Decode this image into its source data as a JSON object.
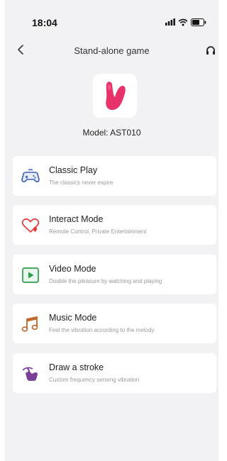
{
  "status_bar": {
    "time": "18:04",
    "icons": [
      "signal-icon",
      "wifi-icon",
      "battery-icon"
    ]
  },
  "nav": {
    "title": "Stand-alone game",
    "back_icon": "chevron-left-icon",
    "support_icon": "headset-icon"
  },
  "device": {
    "model_label": "Model: AST010",
    "image_icon": "device-product-image",
    "accent_color": "#e8336a"
  },
  "menu": {
    "items": [
      {
        "title": "Classic Play",
        "subtitle": "The classics never expire",
        "icon": "gamepad-icon",
        "color": "#3a5bb8"
      },
      {
        "title": "Interact Mode",
        "subtitle": "Remote Control, Private Entertainment",
        "icon": "heart-icon",
        "color": "#e23a3a"
      },
      {
        "title": "Video Mode",
        "subtitle": "Double the pleasure by watching and playing",
        "icon": "play-icon",
        "color": "#2e9d4a"
      },
      {
        "title": "Music Mode",
        "subtitle": "Feel the vibration according to the melody",
        "icon": "music-note-icon",
        "color": "#c0662a"
      },
      {
        "title": "Draw a stroke",
        "subtitle": "Custom frequency sensing vibration",
        "icon": "draw-hand-icon",
        "color": "#7a3f96"
      }
    ]
  }
}
